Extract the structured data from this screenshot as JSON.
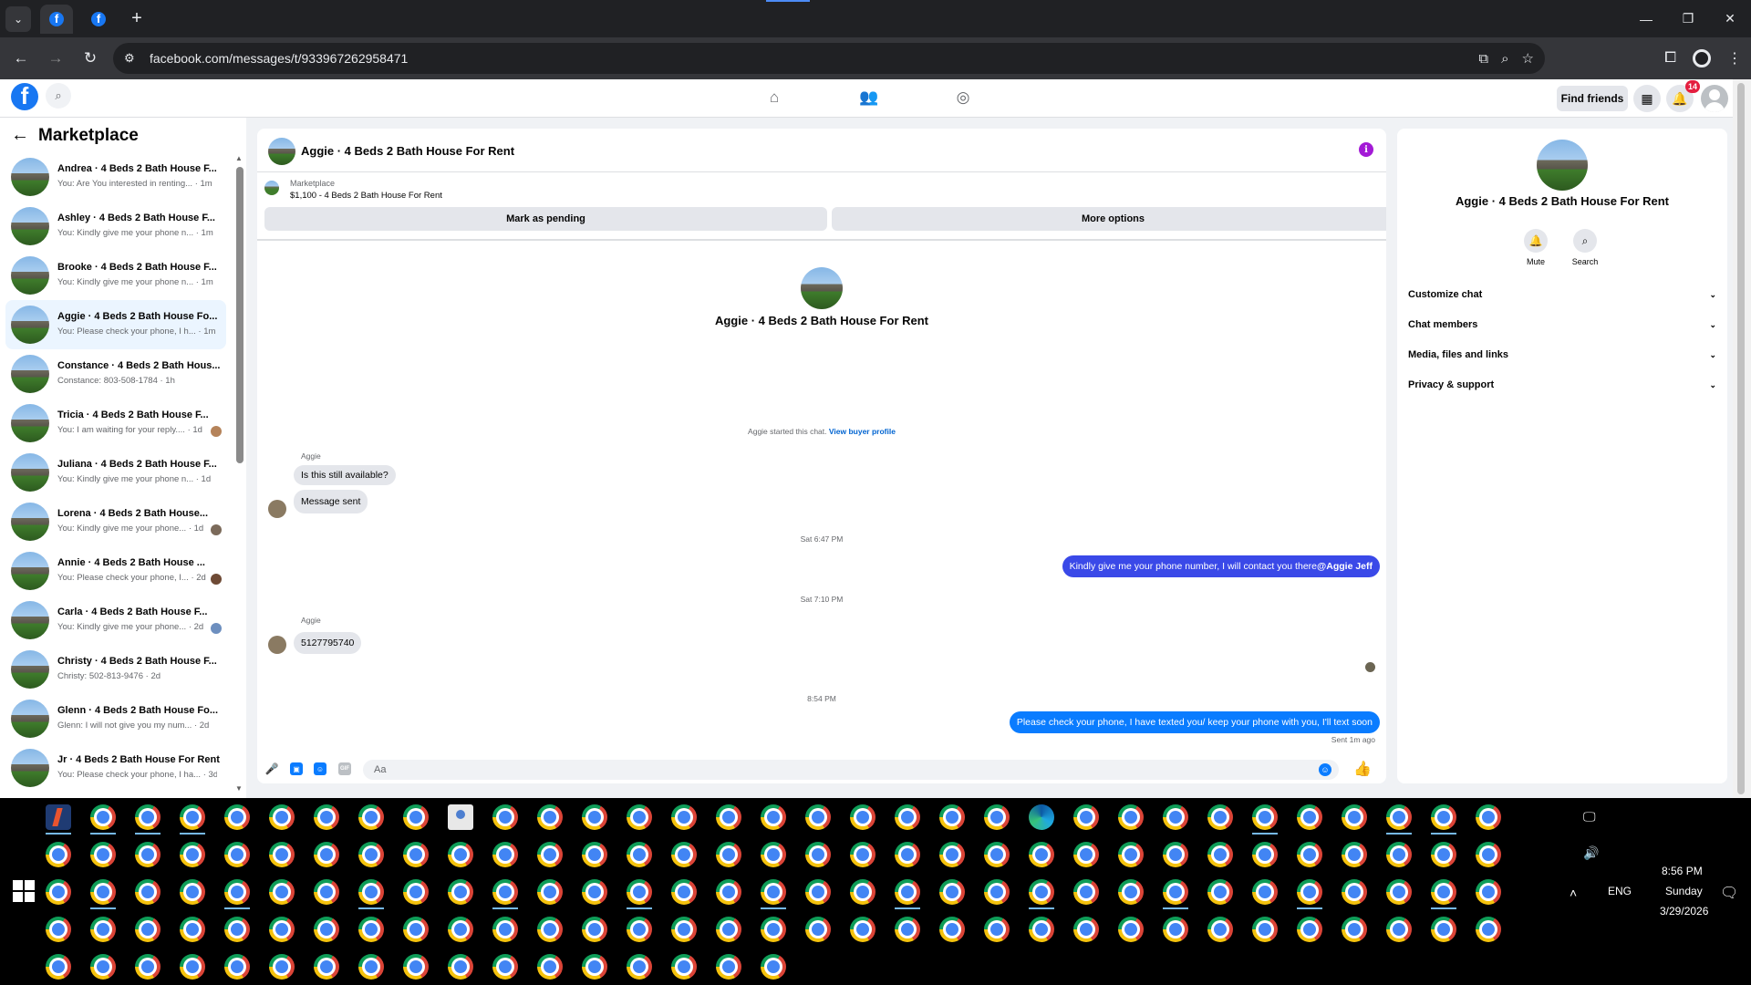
{
  "browser": {
    "url": "facebook.com/messages/t/933967262958471",
    "tab_icon": "facebook-icon"
  },
  "header": {
    "find_friends": "Find friends",
    "notification_count": "14"
  },
  "sidebar": {
    "title": "Marketplace",
    "conversations": [
      {
        "title": "Andrea · 4 Beds 2 Bath House F...",
        "snippet": "You: Are You interested in renting...",
        "time": "· 1m"
      },
      {
        "title": "Ashley · 4 Beds 2 Bath House F...",
        "snippet": "You: Kindly give me your phone n...",
        "time": "· 1m"
      },
      {
        "title": "Brooke · 4 Beds 2 Bath House F...",
        "snippet": "You: Kindly give me your phone n...",
        "time": "· 1m"
      },
      {
        "title": "Aggie · 4 Beds 2 Bath House Fo...",
        "snippet": "You: Please check your phone, I h...",
        "time": "· 1m"
      },
      {
        "title": "Constance · 4 Beds 2 Bath Hous...",
        "snippet": "Constance: 803-508-1784",
        "time": "· 1h"
      },
      {
        "title": "Tricia · 4 Beds 2 Bath House F...",
        "snippet": "You: I am waiting for your reply....",
        "time": "· 1d"
      },
      {
        "title": "Juliana · 4 Beds 2 Bath House F...",
        "snippet": "You: Kindly give me your phone n...",
        "time": "· 1d"
      },
      {
        "title": "Lorena · 4 Beds 2 Bath House...",
        "snippet": "You: Kindly give me your phone...",
        "time": "· 1d"
      },
      {
        "title": "Annie · 4 Beds 2 Bath House ...",
        "snippet": "You: Please check your phone, I...",
        "time": "· 2d"
      },
      {
        "title": "Carla · 4 Beds 2 Bath House F...",
        "snippet": "You: Kindly give me your phone...",
        "time": "· 2d"
      },
      {
        "title": "Christy · 4 Beds 2 Bath House F...",
        "snippet": "Christy: 502-813-9476",
        "time": "· 2d"
      },
      {
        "title": "Glenn · 4 Beds 2 Bath House Fo...",
        "snippet": "Glenn: I will not give you my num...",
        "time": "· 2d"
      },
      {
        "title": "Jr · 4 Beds 2 Bath House For Rent",
        "snippet": "You: Please check your phone, I ha...",
        "time": "· 3d"
      }
    ]
  },
  "chat": {
    "header_name": "Aggie · 4 Beds 2 Bath House For Rent",
    "listing_source": "Marketplace",
    "listing_title": "$1,100 - 4 Beds 2 Bath House For Rent",
    "mark_pending": "Mark as pending",
    "more_options": "More options",
    "center_name": "Aggie · 4 Beds 2 Bath House For Rent",
    "started_text": "Aggie started this chat.",
    "view_buyer": "View buyer profile",
    "sender1": "Aggie",
    "msg1": "Is this still available?",
    "msg2": "Message sent",
    "time1": "Sat 6:47 PM",
    "msg3_text": "Kindly give me your phone number, I will contact you there ",
    "msg3_mention": "@Aggie Jeff",
    "time2": "Sat 7:10 PM",
    "sender2": "Aggie",
    "msg4": "5127795740",
    "time3": "8:54 PM",
    "msg5": "Please check your phone, I have texted you/ keep your phone with you, I'll text soon",
    "sent_status": "Sent 1m ago",
    "composer_placeholder": "Aa"
  },
  "info_panel": {
    "name": "Aggie · 4 Beds 2 Bath House For Rent",
    "mute": "Mute",
    "search": "Search",
    "sections": [
      "Customize chat",
      "Chat members",
      "Media, files and links",
      "Privacy & support"
    ]
  },
  "taskbar": {
    "language": "ENG",
    "time": "8:56 PM",
    "day": "Sunday",
    "date": "3/29/2026"
  }
}
